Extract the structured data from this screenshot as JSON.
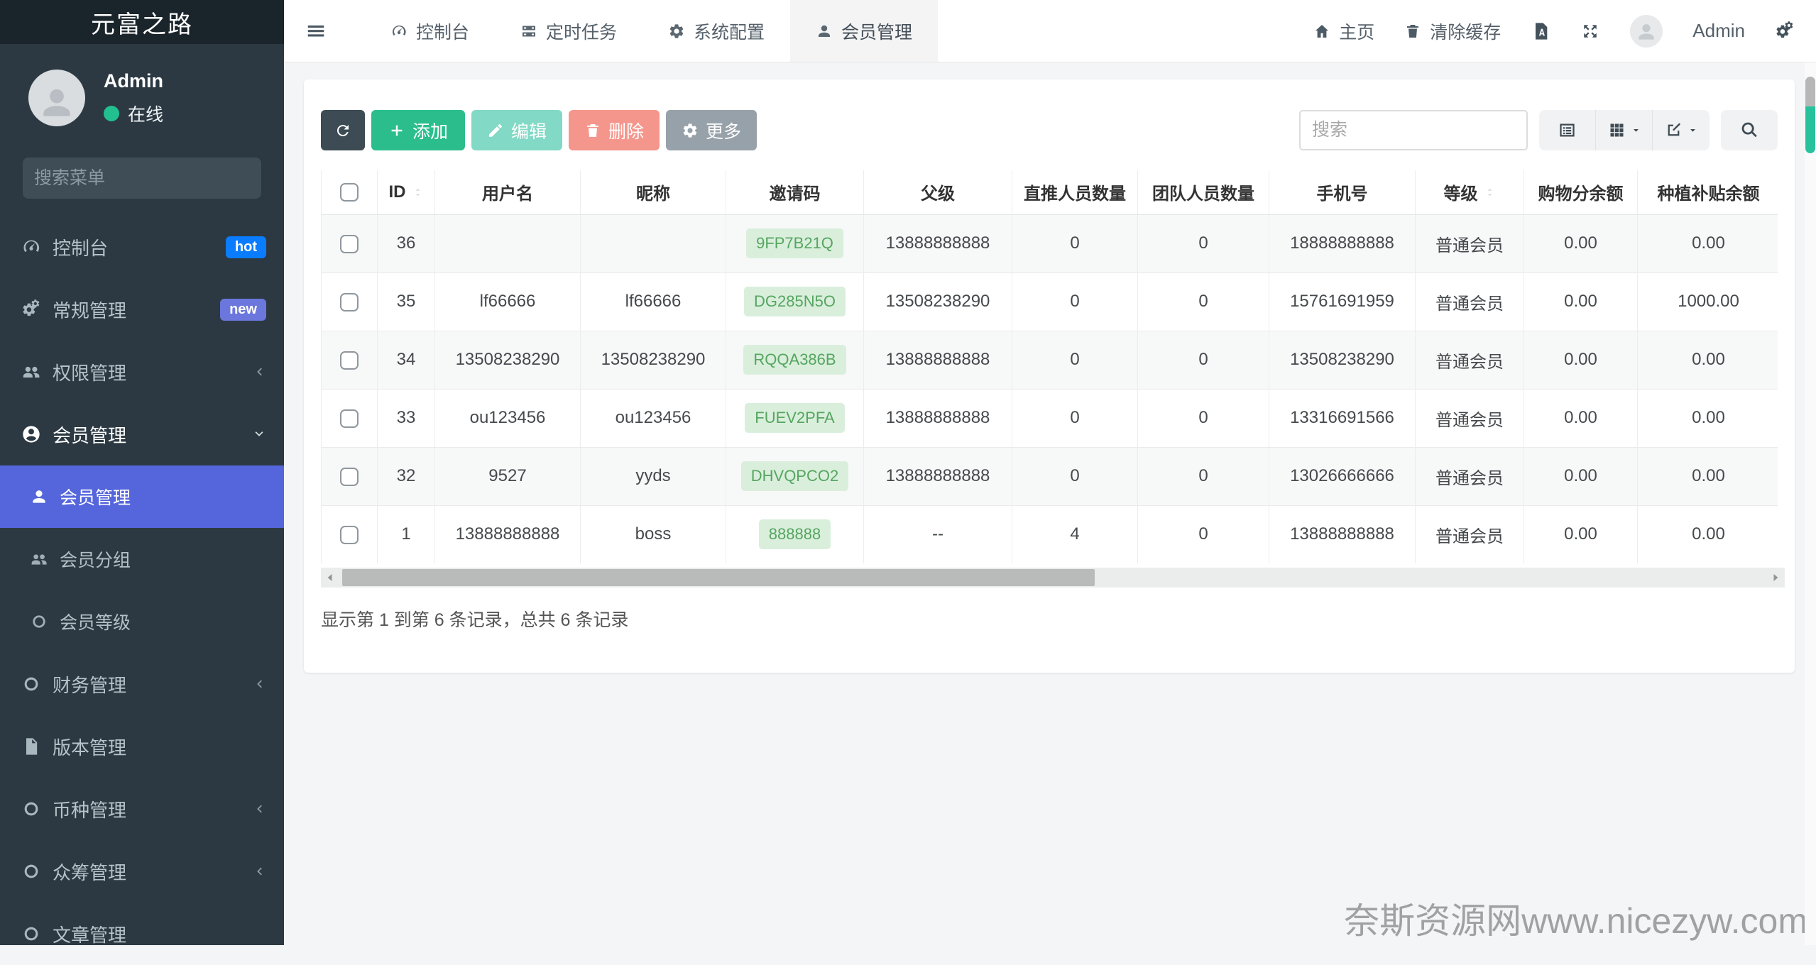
{
  "sidebar": {
    "title": "元富之路",
    "user": {
      "name": "Admin",
      "status": "在线"
    },
    "search_placeholder": "搜索菜单",
    "menu_top": [
      {
        "label": "控制台",
        "badge": "hot"
      },
      {
        "label": "常规管理",
        "badge": "new"
      },
      {
        "label": "权限管理"
      },
      {
        "label": "会员管理"
      }
    ],
    "submenu": [
      {
        "label": "会员管理"
      },
      {
        "label": "会员分组"
      },
      {
        "label": "会员等级"
      }
    ],
    "menu_bottom": [
      {
        "label": "财务管理"
      },
      {
        "label": "版本管理"
      },
      {
        "label": "币种管理"
      },
      {
        "label": "众筹管理"
      },
      {
        "label": "文章管理"
      }
    ]
  },
  "navbar": {
    "tabs": [
      {
        "label": "控制台"
      },
      {
        "label": "定时任务"
      },
      {
        "label": "系统配置"
      },
      {
        "label": "会员管理"
      }
    ],
    "home_label": "主页",
    "clear_cache_label": "清除缓存",
    "username": "Admin"
  },
  "toolbar": {
    "add_label": "添加",
    "edit_label": "编辑",
    "delete_label": "删除",
    "more_label": "更多",
    "search_placeholder": "搜索"
  },
  "table": {
    "columns": [
      "ID",
      "用户名",
      "昵称",
      "邀请码",
      "父级",
      "直推人员数量",
      "团队人员数量",
      "手机号",
      "等级",
      "购物分余额",
      "种植补贴余额"
    ],
    "rows": [
      {
        "id": "36",
        "username": "",
        "nickname": "",
        "invite": "9FP7B21Q",
        "parent": "13888888888",
        "direct": "0",
        "team": "0",
        "phone": "18888888888",
        "level": "普通会员",
        "shopping": "0.00",
        "subsidy": "0.00"
      },
      {
        "id": "35",
        "username": "lf66666",
        "nickname": "lf66666",
        "invite": "DG285N5O",
        "parent": "13508238290",
        "direct": "0",
        "team": "0",
        "phone": "15761691959",
        "level": "普通会员",
        "shopping": "0.00",
        "subsidy": "1000.00"
      },
      {
        "id": "34",
        "username": "13508238290",
        "nickname": "13508238290",
        "invite": "RQQA386B",
        "parent": "13888888888",
        "direct": "0",
        "team": "0",
        "phone": "13508238290",
        "level": "普通会员",
        "shopping": "0.00",
        "subsidy": "0.00"
      },
      {
        "id": "33",
        "username": "ou123456",
        "nickname": "ou123456",
        "invite": "FUEV2PFA",
        "parent": "13888888888",
        "direct": "0",
        "team": "0",
        "phone": "13316691566",
        "level": "普通会员",
        "shopping": "0.00",
        "subsidy": "0.00"
      },
      {
        "id": "32",
        "username": "9527",
        "nickname": "yyds",
        "invite": "DHVQPCO2",
        "parent": "13888888888",
        "direct": "0",
        "team": "0",
        "phone": "13026666666",
        "level": "普通会员",
        "shopping": "0.00",
        "subsidy": "0.00"
      },
      {
        "id": "1",
        "username": "13888888888",
        "nickname": "boss",
        "invite": "888888",
        "parent": "--",
        "direct": "4",
        "team": "0",
        "phone": "13888888888",
        "level": "普通会员",
        "shopping": "0.00",
        "subsidy": "0.00"
      }
    ],
    "summary": "显示第 1 到第 6 条记录，总共 6 条记录"
  },
  "watermark": "奈斯资源网www.nicezyw.com",
  "colors": {
    "sidebar_bg": "#2c3942",
    "sidebar_active": "#5566dc",
    "badge_hot": "#0a7cff",
    "badge_new": "#6b77dd",
    "online_dot": "#23c08f",
    "btn_refresh": "#3c4b54",
    "btn_add": "#2bbe8c",
    "btn_edit": "#82d9c5",
    "btn_delete": "#f5968c",
    "btn_more": "#97a1a9",
    "invite_badge_bg": "#d9efdc",
    "invite_badge_text": "#56a560"
  }
}
